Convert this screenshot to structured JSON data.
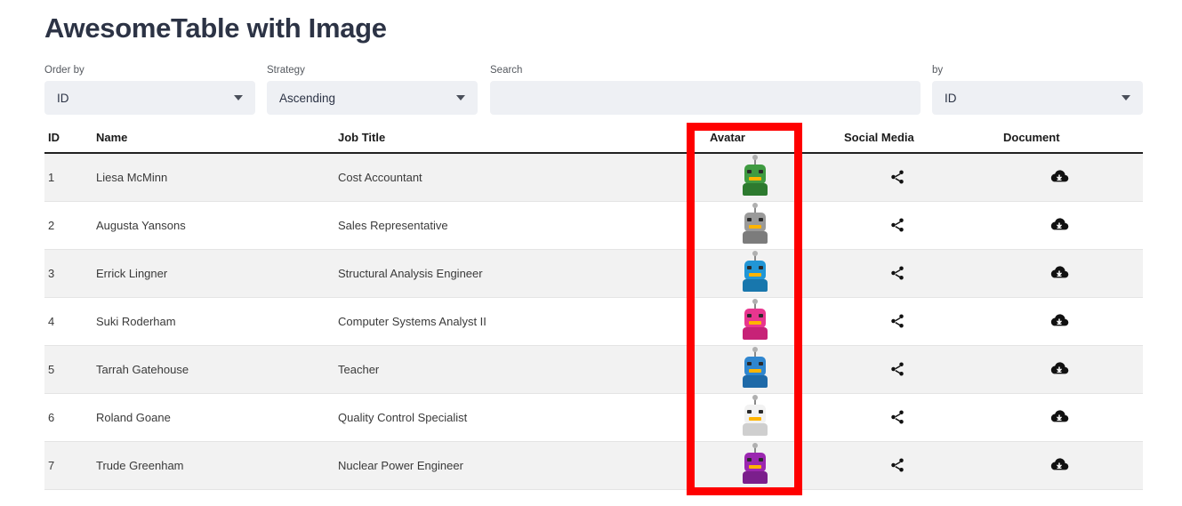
{
  "header": {
    "title": "AwesomeTable with Image"
  },
  "controls": {
    "order_by": {
      "label": "Order by",
      "value": "ID"
    },
    "strategy": {
      "label": "Strategy",
      "value": "Ascending"
    },
    "search": {
      "label": "Search",
      "value": "",
      "placeholder": ""
    },
    "by": {
      "label": "by",
      "value": "ID"
    }
  },
  "table": {
    "columns": [
      {
        "key": "id",
        "label": "ID"
      },
      {
        "key": "name",
        "label": "Name"
      },
      {
        "key": "job",
        "label": "Job Title"
      },
      {
        "key": "avatar",
        "label": "Avatar"
      },
      {
        "key": "social",
        "label": "Social Media"
      },
      {
        "key": "doc",
        "label": "Document"
      }
    ],
    "rows": [
      {
        "id": "1",
        "name": "Liesa McMinn",
        "job": "Cost Accountant",
        "avatar_color": "#3f9b41",
        "avatar_accent": "#2d7a2f",
        "social_icon": "share-icon",
        "doc_icon": "cloud-download-icon"
      },
      {
        "id": "2",
        "name": "Augusta Yansons",
        "job": "Sales Representative",
        "avatar_color": "#9a9a9a",
        "avatar_accent": "#7c7c7c",
        "social_icon": "share-icon",
        "doc_icon": "cloud-download-icon"
      },
      {
        "id": "3",
        "name": "Errick Lingner",
        "job": "Structural Analysis Engineer",
        "avatar_color": "#2196d6",
        "avatar_accent": "#1877ad",
        "social_icon": "share-icon",
        "doc_icon": "cloud-download-icon"
      },
      {
        "id": "4",
        "name": "Suki Roderham",
        "job": "Computer Systems Analyst II",
        "avatar_color": "#e8368f",
        "avatar_accent": "#c72277",
        "social_icon": "share-icon",
        "doc_icon": "cloud-download-icon"
      },
      {
        "id": "5",
        "name": "Tarrah Gatehouse",
        "job": "Teacher",
        "avatar_color": "#2f86cf",
        "avatar_accent": "#1f6aa8",
        "social_icon": "share-icon",
        "doc_icon": "cloud-download-icon"
      },
      {
        "id": "6",
        "name": "Roland Goane",
        "job": "Quality Control Specialist",
        "avatar_color": "#f2f2f2",
        "avatar_accent": "#cfcfcf",
        "social_icon": "share-icon",
        "doc_icon": "cloud-download-icon"
      },
      {
        "id": "7",
        "name": "Trude Greenham",
        "job": "Nuclear Power Engineer",
        "avatar_color": "#9b27b0",
        "avatar_accent": "#7b1f8c",
        "social_icon": "share-icon",
        "doc_icon": "cloud-download-icon"
      }
    ]
  },
  "annotation": {
    "color": "#fe0000",
    "target_column": "Avatar"
  },
  "colors": {
    "title": "#2c3345",
    "control_bg": "#eef0f4",
    "row_stripe": "#f2f2f2",
    "header_rule": "#212121",
    "annotation": "#fe0000"
  }
}
